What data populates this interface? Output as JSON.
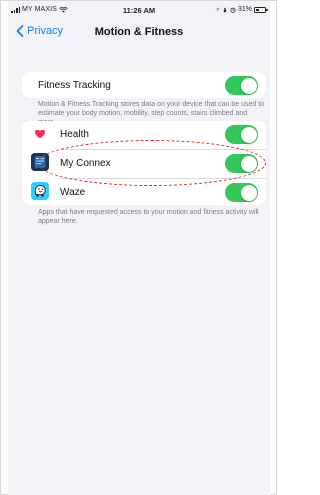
{
  "status_bar": {
    "carrier": "MY MAXIS",
    "time": "11:26 AM",
    "battery": "31%"
  },
  "nav": {
    "back_label": "Privacy",
    "title": "Motion & Fitness"
  },
  "fitness": {
    "label": "Fitness Tracking",
    "enabled": true,
    "footnote": "Motion & Fitness Tracking stores data on your device that can be used to estimate your body motion, mobility, step counts, stairs climbed and more."
  },
  "apps": [
    {
      "name": "Health",
      "icon": "heart-icon",
      "enabled": true
    },
    {
      "name": "My Connex",
      "icon": "connex-app-icon",
      "enabled": true
    },
    {
      "name": "Waze",
      "icon": "waze-app-icon",
      "enabled": true
    }
  ],
  "apps_footnote": "Apps that have requested access to your motion and fitness activity will appear here.",
  "colors": {
    "accent": "#0a84ff",
    "toggle_on": "#34c759",
    "background": "#f2f2f7",
    "annotation": "#e02020"
  }
}
